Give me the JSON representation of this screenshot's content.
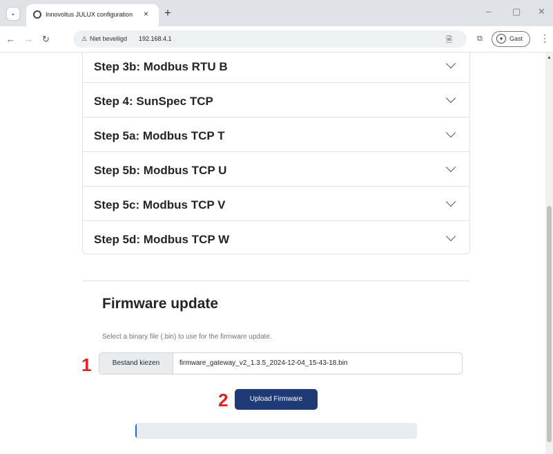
{
  "browser": {
    "tab_title": "Innovoltus JULUX configuration",
    "tab_close": "×",
    "new_tab": "+",
    "window_controls": [
      "–",
      "▢",
      "✕"
    ],
    "security_label": "Niet beveiligd",
    "url": "192.168.4.1",
    "profile_label": "Gast",
    "icons": [
      "chevron-down-icon",
      "globe-icon",
      "back-icon",
      "forward-icon",
      "reload-icon",
      "warning-icon",
      "translate-icon",
      "extensions-icon",
      "guest-icon",
      "menu-icon"
    ]
  },
  "accordion": {
    "items": [
      {
        "label": "Step 3b: Modbus RTU B"
      },
      {
        "label": "Step 4: SunSpec TCP"
      },
      {
        "label": "Step 5a: Modbus TCP T"
      },
      {
        "label": "Step 5b: Modbus TCP U"
      },
      {
        "label": "Step 5c: Modbus TCP V"
      },
      {
        "label": "Step 5d: Modbus TCP W"
      }
    ]
  },
  "firmware": {
    "title": "Firmware update",
    "description": "Select a binary file (.bin) to use for the firmware update.",
    "file_button": "Bestand kiezen",
    "file_name": "firmware_gateway_v2_1.3.5_2024-12-04_15-43-18.bin",
    "upload_label": "Upload Firmware",
    "progress_fraction": 0.005
  },
  "annotations": {
    "step1": "1",
    "step2": "2",
    "color": "#e52222"
  }
}
